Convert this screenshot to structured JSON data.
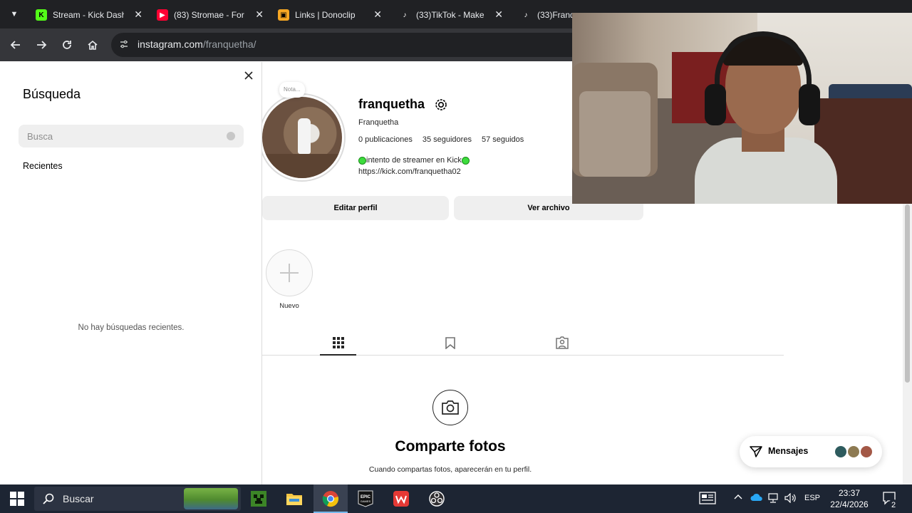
{
  "browser": {
    "tabs": [
      {
        "title": "Stream - Kick Dash",
        "favicon": "kick-icon",
        "color": "#53fc18"
      },
      {
        "title": "(83) Stromae - For",
        "favicon": "youtube-icon",
        "color": "#ff0033"
      },
      {
        "title": "Links | Donoclip",
        "favicon": "donoclip-icon",
        "color": "#f5a623"
      },
      {
        "title": "(33)TikTok - Make",
        "favicon": "tiktok-icon",
        "color": "#ffffff"
      },
      {
        "title": "(33)Franq",
        "favicon": "tiktok-icon",
        "color": "#ffffff"
      }
    ],
    "url_host": "instagram.com",
    "url_path": "/franquetha/"
  },
  "search_panel": {
    "title": "Búsqueda",
    "placeholder": "Busca",
    "recent_label": "Recientes",
    "empty_text": "No hay búsquedas recientes."
  },
  "profile": {
    "note": "Nota...",
    "username": "franquetha",
    "full_name": "Franquetha",
    "posts": "0 publicaciones",
    "followers": "35 seguidores",
    "following": "57 seguidos",
    "bio_line1": "intento de streamer en Kick",
    "bio_link": "https://kick.com/franquetha02",
    "edit_button": "Editar perfil",
    "archive_button": "Ver archivo",
    "highlight_new": "Nuevo",
    "empty_title": "Comparte fotos",
    "empty_sub": "Cuando compartas fotos, aparecerán en tu perfil."
  },
  "messages": {
    "label": "Mensajes"
  },
  "taskbar": {
    "search_text": "Buscar",
    "language": "ESP",
    "time": "23:37",
    "date": "22/4/2026",
    "notification_count": "2"
  },
  "colors": {
    "instagram_text": "#000000",
    "tab_bg": "#202124",
    "taskbar_bg": "#1d2533"
  }
}
